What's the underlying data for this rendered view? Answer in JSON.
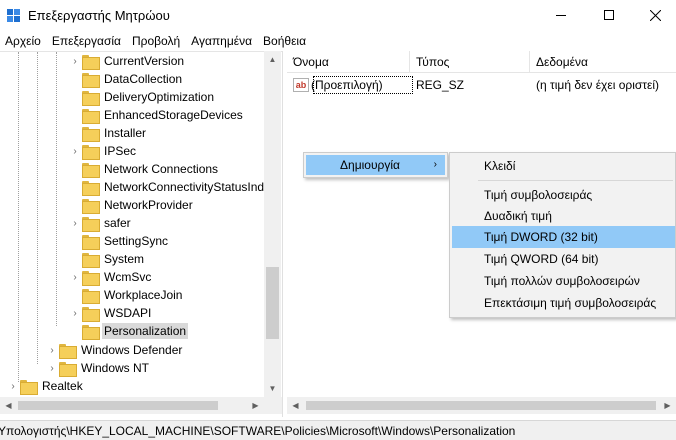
{
  "window": {
    "title": "Επεξεργαστής Μητρώου"
  },
  "menubar": [
    "Αρχείο",
    "Επεξεργασία",
    "Προβολή",
    "Αγαπημένα",
    "Βοήθεια"
  ],
  "tree": {
    "items": [
      {
        "label": "CurrentVersion",
        "expandable": true
      },
      {
        "label": "DataCollection",
        "expandable": false
      },
      {
        "label": "DeliveryOptimization",
        "expandable": false
      },
      {
        "label": "EnhancedStorageDevices",
        "expandable": false
      },
      {
        "label": "Installer",
        "expandable": false
      },
      {
        "label": "IPSec",
        "expandable": true
      },
      {
        "label": "Network Connections",
        "expandable": false
      },
      {
        "label": "NetworkConnectivityStatusInd",
        "expandable": false
      },
      {
        "label": "NetworkProvider",
        "expandable": false
      },
      {
        "label": "safer",
        "expandable": true
      },
      {
        "label": "SettingSync",
        "expandable": false
      },
      {
        "label": "System",
        "expandable": false
      },
      {
        "label": "WcmSvc",
        "expandable": true
      },
      {
        "label": "WorkplaceJoin",
        "expandable": false
      },
      {
        "label": "WSDAPI",
        "expandable": true
      },
      {
        "label": "Personalization",
        "expandable": false,
        "selected": true
      }
    ],
    "level2": [
      {
        "label": "Windows Defender",
        "expandable": true
      },
      {
        "label": "Windows NT",
        "expandable": true
      }
    ],
    "level0": [
      {
        "label": "Realtek",
        "expandable": true
      }
    ]
  },
  "list": {
    "columns": [
      "Όνομα",
      "Τύπος",
      "Δεδομένα"
    ],
    "rows": [
      {
        "icon": "ab",
        "name": "(Προεπιλογή)",
        "type": "REG_SZ",
        "data": "(η τιμή δεν έχει οριστεί)"
      }
    ]
  },
  "context_menu": {
    "item": "Δημιουργία",
    "submenu": [
      "Κλειδί",
      "Τιμή συμβολοσειράς",
      "Δυαδική τιμή",
      "Τιμή DWORD (32 bit)",
      "Τιμή QWORD (64 bit)",
      "Τιμή πολλών συμβολοσειρών",
      "Επεκτάσιμη τιμή συμβολοσειράς"
    ],
    "highlighted": "Τιμή DWORD (32 bit)"
  },
  "status": {
    "path": "Υπολογιστής\\HKEY_LOCAL_MACHINE\\SOFTWARE\\Policies\\Microsoft\\Windows\\Personalization"
  },
  "colors": {
    "highlight": "#91c9f7",
    "folder": "#f5cf5a",
    "selection": "#d9d9d9"
  }
}
